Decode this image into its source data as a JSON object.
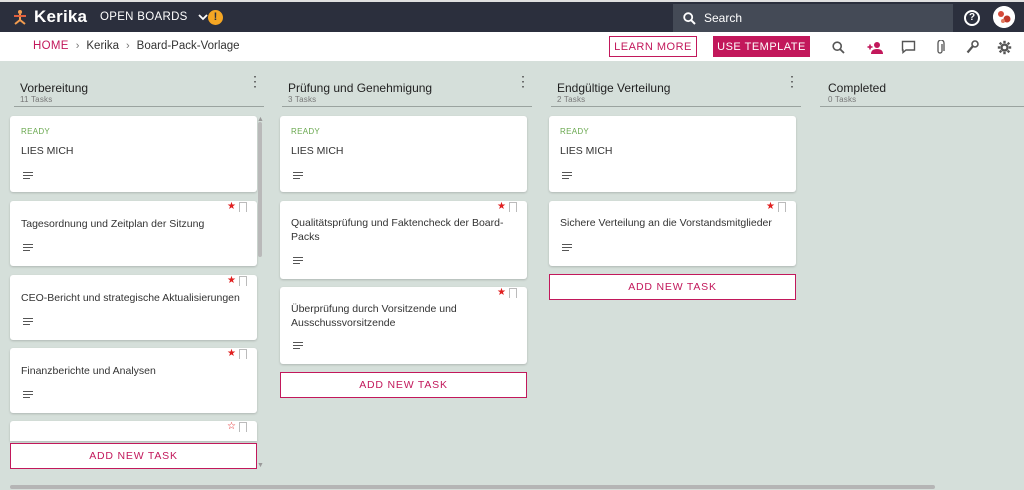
{
  "app": {
    "logo_text": "Kerika",
    "open_boards_label": "OPEN BOARDS",
    "alert_badge": "!",
    "search_placeholder": "Search",
    "help_glyph": "?"
  },
  "breadcrumb": {
    "home": "HOME",
    "sep1": "›",
    "workspace": "Kerika",
    "sep2": "›",
    "board": "Board-Pack-Vorlage"
  },
  "toolbar": {
    "learn_more": "LEARN MORE",
    "use_template": "USE TEMPLATE"
  },
  "colors": {
    "accent": "#c2185b",
    "topbar": "#2b2f3d",
    "background": "#d5dfda",
    "ready": "#6aa84f",
    "star": "#e02020"
  },
  "columns": [
    {
      "title": "Vorbereitung",
      "count": "11 Tasks",
      "add_task": "ADD NEW TASK",
      "cards": [
        {
          "status": "READY",
          "title": "LIES MICH"
        },
        {
          "title": "Tagesordnung und Zeitplan der Sitzung"
        },
        {
          "title": "CEO-Bericht und strategische Aktualisierungen"
        },
        {
          "title": "Finanzberichte und Analysen"
        },
        {
          "title": ""
        }
      ]
    },
    {
      "title": "Prüfung und Genehmigung",
      "count": "3 Tasks",
      "add_task": "ADD NEW TASK",
      "cards": [
        {
          "status": "READY",
          "title": "LIES MICH"
        },
        {
          "title": "Qualitätsprüfung und Faktencheck der Board-Packs"
        },
        {
          "title": "Überprüfung durch Vorsitzende und Ausschussvorsitzende"
        }
      ]
    },
    {
      "title": "Endgültige Verteilung",
      "count": "2 Tasks",
      "add_task": "ADD NEW TASK",
      "cards": [
        {
          "status": "READY",
          "title": "LIES MICH"
        },
        {
          "title": "Sichere Verteilung an die Vorstandsmitglieder"
        }
      ]
    },
    {
      "title": "Completed",
      "count": "0 Tasks"
    }
  ]
}
